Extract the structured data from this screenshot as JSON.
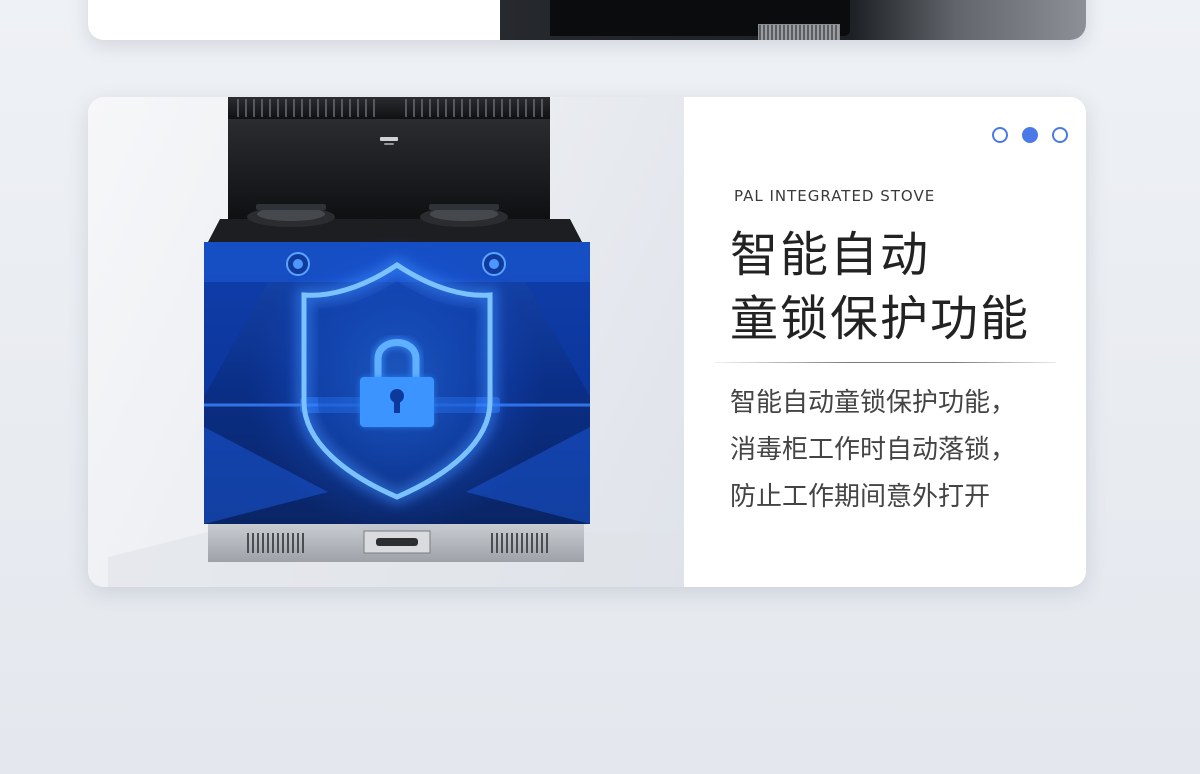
{
  "page": {
    "brand_subtitle": "PAL INTEGRATED STOVE",
    "title_lines": [
      "智能自动",
      "童锁保护功能"
    ],
    "description_lines": [
      "智能自动童锁保护功能，",
      "消毒柜工作时自动落锁，",
      "防止工作期间意外打开"
    ],
    "carousel": {
      "slide_count": 3,
      "active_index": 1
    },
    "colors": {
      "accent": "#4c79e8",
      "glow": "#2f8bff",
      "cabinet": "#0a2a78"
    },
    "icons": [
      "shield-icon",
      "lock-icon"
    ]
  }
}
